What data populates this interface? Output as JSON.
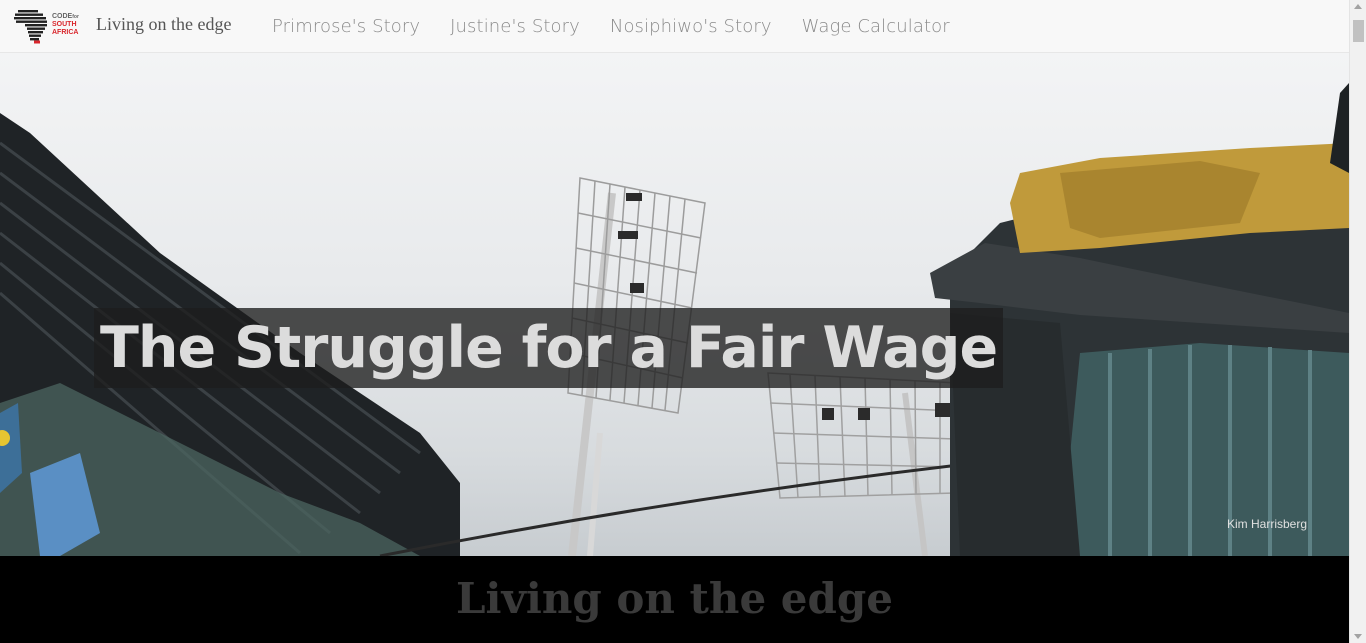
{
  "navbar": {
    "logo": {
      "icon": "africa-map-logo",
      "line1": "CODE",
      "line1_suffix": "for",
      "line2": "SOUTH",
      "line3": "AFRICA",
      "accent_color": "#d9262c"
    },
    "brand": "Living on the edge",
    "links": [
      {
        "label": "Primrose's Story"
      },
      {
        "label": "Justine's Story"
      },
      {
        "label": "Nosiphiwo's Story"
      },
      {
        "label": "Wage Calculator"
      }
    ]
  },
  "hero": {
    "title": "The Struggle for a Fair Wage",
    "photo_credit": "Kim Harrisberg"
  },
  "section": {
    "heading": "Living on the edge"
  },
  "colors": {
    "navbar_bg": "#f8f8f8",
    "nav_text": "#8a8a8a",
    "brand_text": "#555555",
    "section_bg": "#000000",
    "section_heading": "#3a3a3a"
  }
}
